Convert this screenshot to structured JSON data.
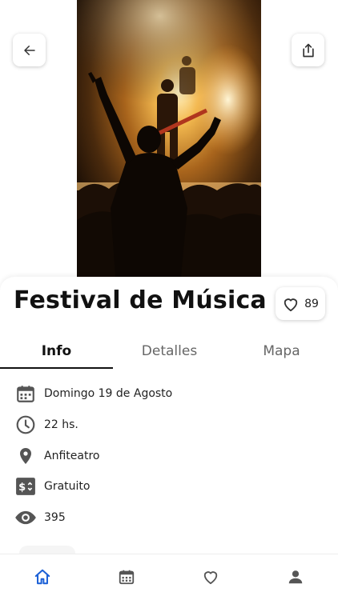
{
  "colors": {
    "accent": "#1a5fd6",
    "icon": "#555555",
    "text": "#222222"
  },
  "hero": {
    "alt_icon": "concert-photo"
  },
  "header": {
    "back_icon": "arrow-left-icon",
    "share_icon": "share-icon"
  },
  "event": {
    "title": "Festival de Música",
    "likes": "89"
  },
  "tabs": [
    {
      "label": "Info",
      "selected": true
    },
    {
      "label": "Detalles",
      "selected": false
    },
    {
      "label": "Mapa",
      "selected": false
    }
  ],
  "info": [
    {
      "icon": "calendar-icon",
      "text": "Domingo 19 de Agosto"
    },
    {
      "icon": "clock-icon",
      "text": "22 hs."
    },
    {
      "icon": "location-pin-icon",
      "text": "Anfiteatro"
    },
    {
      "icon": "price-tag-icon",
      "text": "Gratuito"
    },
    {
      "icon": "eye-icon",
      "text": "395"
    }
  ],
  "bottom_nav": [
    {
      "icon": "home-icon",
      "active": true
    },
    {
      "icon": "calendar-icon",
      "active": false
    },
    {
      "icon": "heart-icon",
      "active": false
    },
    {
      "icon": "person-icon",
      "active": false
    }
  ]
}
